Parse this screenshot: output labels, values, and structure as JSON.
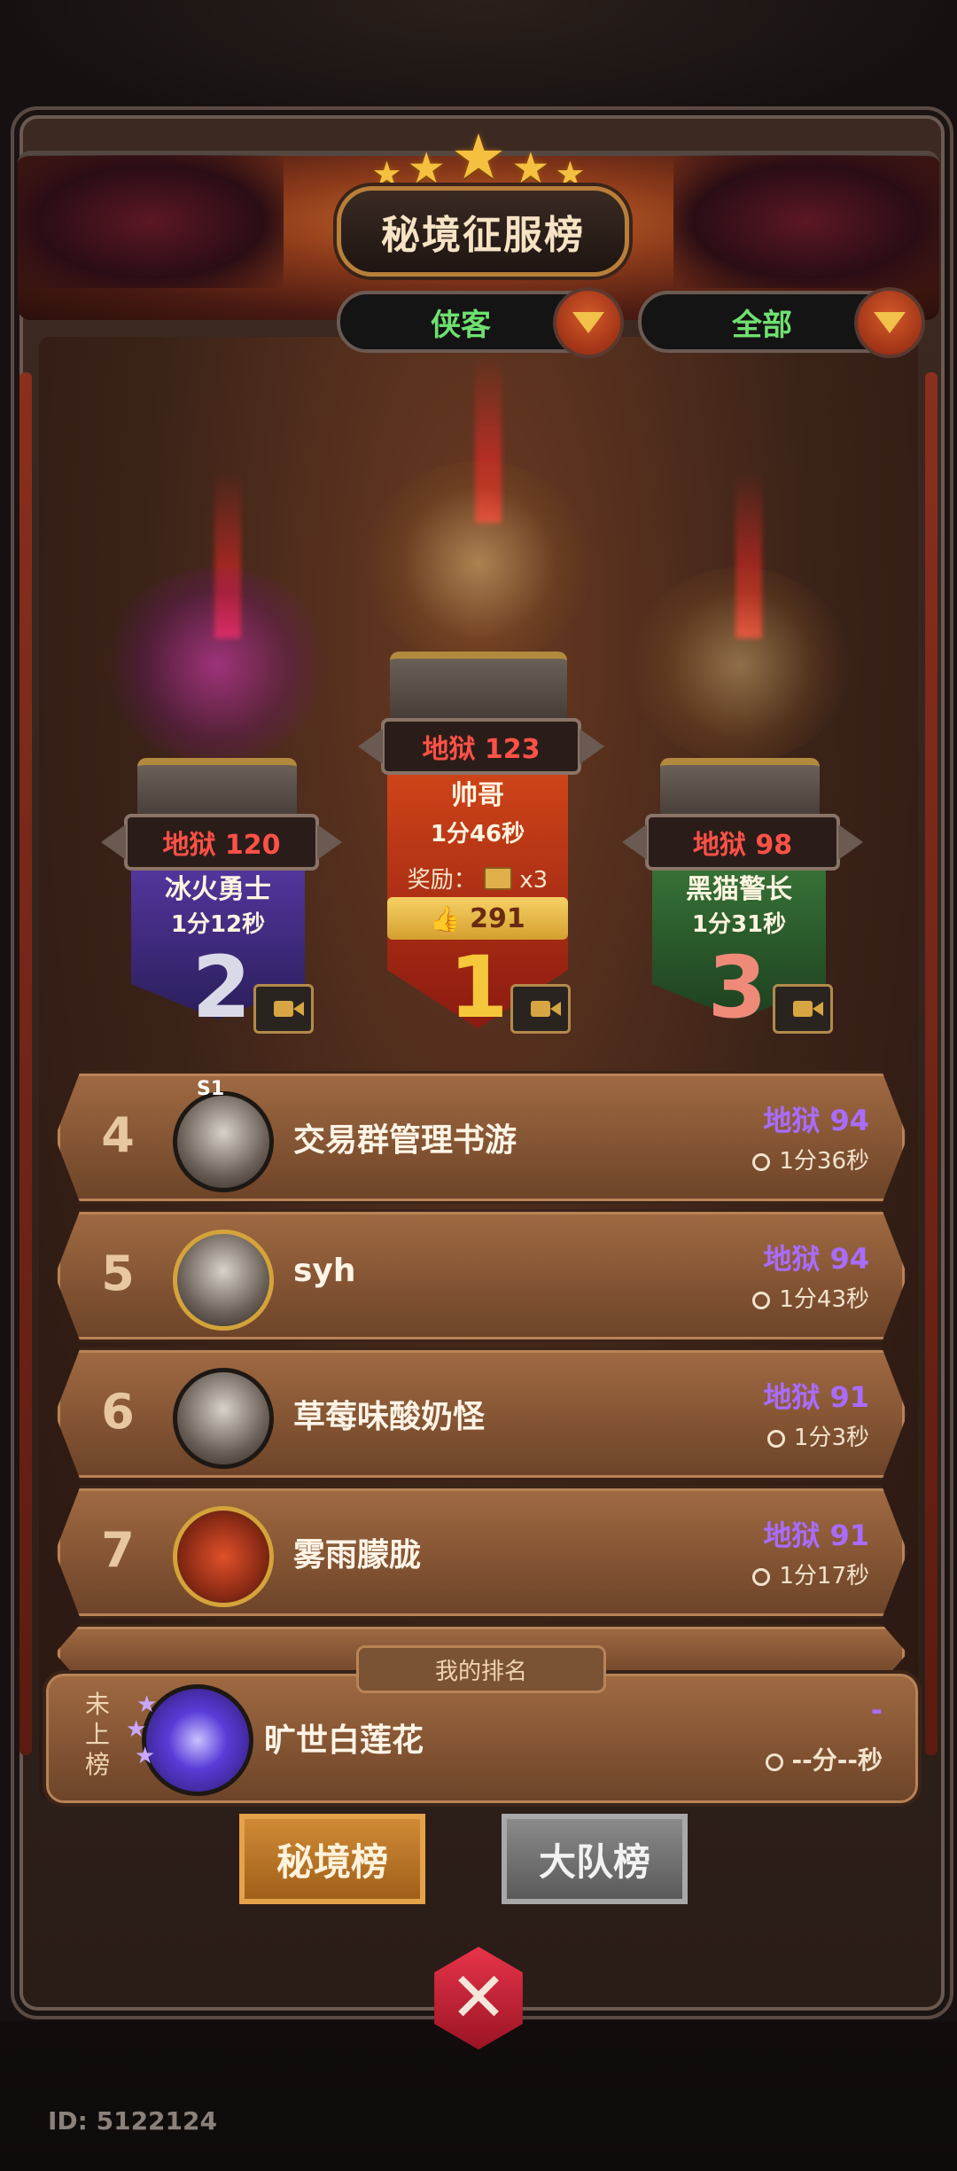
{
  "header": {
    "title": "秘境征服榜"
  },
  "filters": {
    "class_filter": "侠客",
    "scope_filter": "全部"
  },
  "podium": [
    {
      "rank": "2",
      "hell": "地狱 120",
      "name": "冰火勇士",
      "time": "1分12秒",
      "color": "#5a3aa8"
    },
    {
      "rank": "1",
      "hell": "地狱 123",
      "name": "帅哥",
      "time": "1分46秒",
      "reward_label": "奖励：",
      "reward_qty": "x3",
      "likes": "291",
      "color": "#d84a1a"
    },
    {
      "rank": "3",
      "hell": "地狱 98",
      "name": "黑猫警长",
      "time": "1分31秒",
      "color": "#3a7a3a"
    }
  ],
  "list": [
    {
      "rank": "4",
      "name": "交易群管理书游",
      "hell": "地狱 94",
      "time": "1分36秒",
      "badge": "S1"
    },
    {
      "rank": "5",
      "name": "syh",
      "hell": "地狱 94",
      "time": "1分43秒"
    },
    {
      "rank": "6",
      "name": "草莓味酸奶怪",
      "hell": "地狱 91",
      "time": "1分3秒"
    },
    {
      "rank": "7",
      "name": "雾雨朦胧",
      "hell": "地狱 91",
      "time": "1分17秒"
    }
  ],
  "my_rank": {
    "label": "我的排名",
    "status": "未上榜",
    "name": "旷世白莲花",
    "hell": "-",
    "time": "--分--秒"
  },
  "tabs": {
    "secret": "秘境榜",
    "team": "大队榜"
  },
  "footer": {
    "id": "ID: 5122124"
  },
  "colors": {
    "hell_red": "#ff5147",
    "hell_purple": "#a96cff",
    "filter_green": "#6fe070",
    "accent_gold": "#d7a642"
  }
}
